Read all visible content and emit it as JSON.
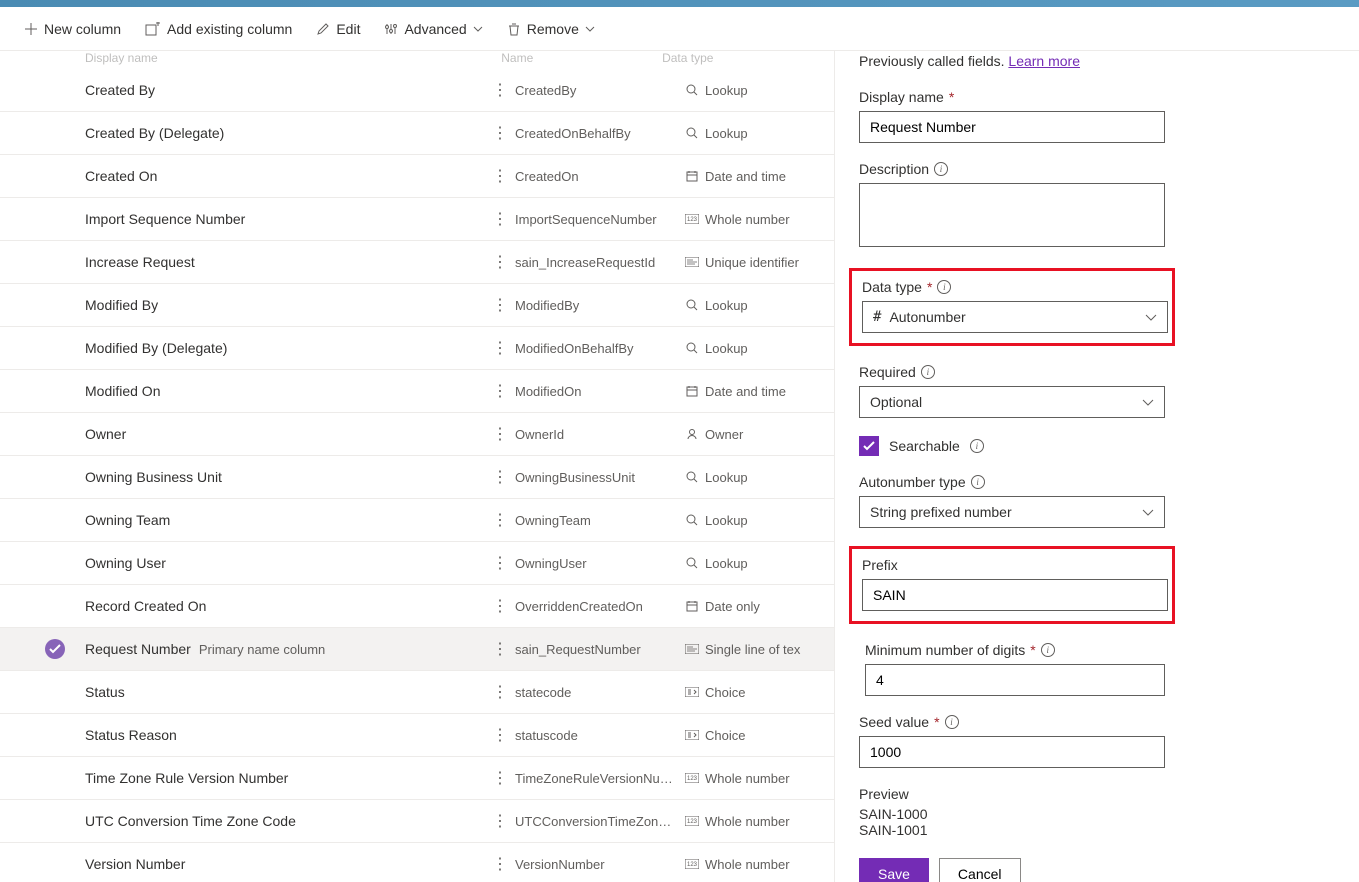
{
  "toolbar": {
    "new_column": "New column",
    "add_existing": "Add existing column",
    "edit": "Edit",
    "advanced": "Advanced",
    "remove": "Remove"
  },
  "table": {
    "headers": {
      "display": "Display name",
      "name": "Name",
      "type": "Data type"
    },
    "rows": [
      {
        "display": "Created By",
        "name": "CreatedBy",
        "type": "Lookup",
        "icon": "lookup"
      },
      {
        "display": "Created By (Delegate)",
        "name": "CreatedOnBehalfBy",
        "type": "Lookup",
        "icon": "lookup"
      },
      {
        "display": "Created On",
        "name": "CreatedOn",
        "type": "Date and time",
        "icon": "date"
      },
      {
        "display": "Import Sequence Number",
        "name": "ImportSequenceNumber",
        "type": "Whole number",
        "icon": "number"
      },
      {
        "display": "Increase Request",
        "name": "sain_IncreaseRequestId",
        "type": "Unique identifier",
        "icon": "text"
      },
      {
        "display": "Modified By",
        "name": "ModifiedBy",
        "type": "Lookup",
        "icon": "lookup"
      },
      {
        "display": "Modified By (Delegate)",
        "name": "ModifiedOnBehalfBy",
        "type": "Lookup",
        "icon": "lookup"
      },
      {
        "display": "Modified On",
        "name": "ModifiedOn",
        "type": "Date and time",
        "icon": "date"
      },
      {
        "display": "Owner",
        "name": "OwnerId",
        "type": "Owner",
        "icon": "owner"
      },
      {
        "display": "Owning Business Unit",
        "name": "OwningBusinessUnit",
        "type": "Lookup",
        "icon": "lookup"
      },
      {
        "display": "Owning Team",
        "name": "OwningTeam",
        "type": "Lookup",
        "icon": "lookup"
      },
      {
        "display": "Owning User",
        "name": "OwningUser",
        "type": "Lookup",
        "icon": "lookup"
      },
      {
        "display": "Record Created On",
        "name": "OverriddenCreatedOn",
        "type": "Date only",
        "icon": "date"
      },
      {
        "display": "Request Number",
        "name": "sain_RequestNumber",
        "type": "Single line of tex",
        "icon": "text",
        "selected": true,
        "primary": "Primary name column"
      },
      {
        "display": "Status",
        "name": "statecode",
        "type": "Choice",
        "icon": "choice"
      },
      {
        "display": "Status Reason",
        "name": "statuscode",
        "type": "Choice",
        "icon": "choice"
      },
      {
        "display": "Time Zone Rule Version Number",
        "name": "TimeZoneRuleVersionNum...",
        "type": "Whole number",
        "icon": "number"
      },
      {
        "display": "UTC Conversion Time Zone Code",
        "name": "UTCConversionTimeZoneC...",
        "type": "Whole number",
        "icon": "number"
      },
      {
        "display": "Version Number",
        "name": "VersionNumber",
        "type": "Whole number",
        "icon": "number"
      }
    ]
  },
  "panel": {
    "intro_prefix": "Previously called fields. ",
    "intro_link": "Learn more",
    "display_name_label": "Display name",
    "display_name_value": "Request Number",
    "description_label": "Description",
    "description_value": "",
    "data_type_label": "Data type",
    "data_type_value": "Autonumber",
    "required_label": "Required",
    "required_value": "Optional",
    "searchable_label": "Searchable",
    "autonumber_type_label": "Autonumber type",
    "autonumber_type_value": "String prefixed number",
    "prefix_label": "Prefix",
    "prefix_value": "SAIN",
    "min_digits_label": "Minimum number of digits",
    "min_digits_value": "4",
    "seed_label": "Seed value",
    "seed_value": "1000",
    "preview_label": "Preview",
    "preview_lines": [
      "SAIN-1000",
      "SAIN-1001"
    ],
    "save": "Save",
    "cancel": "Cancel"
  }
}
